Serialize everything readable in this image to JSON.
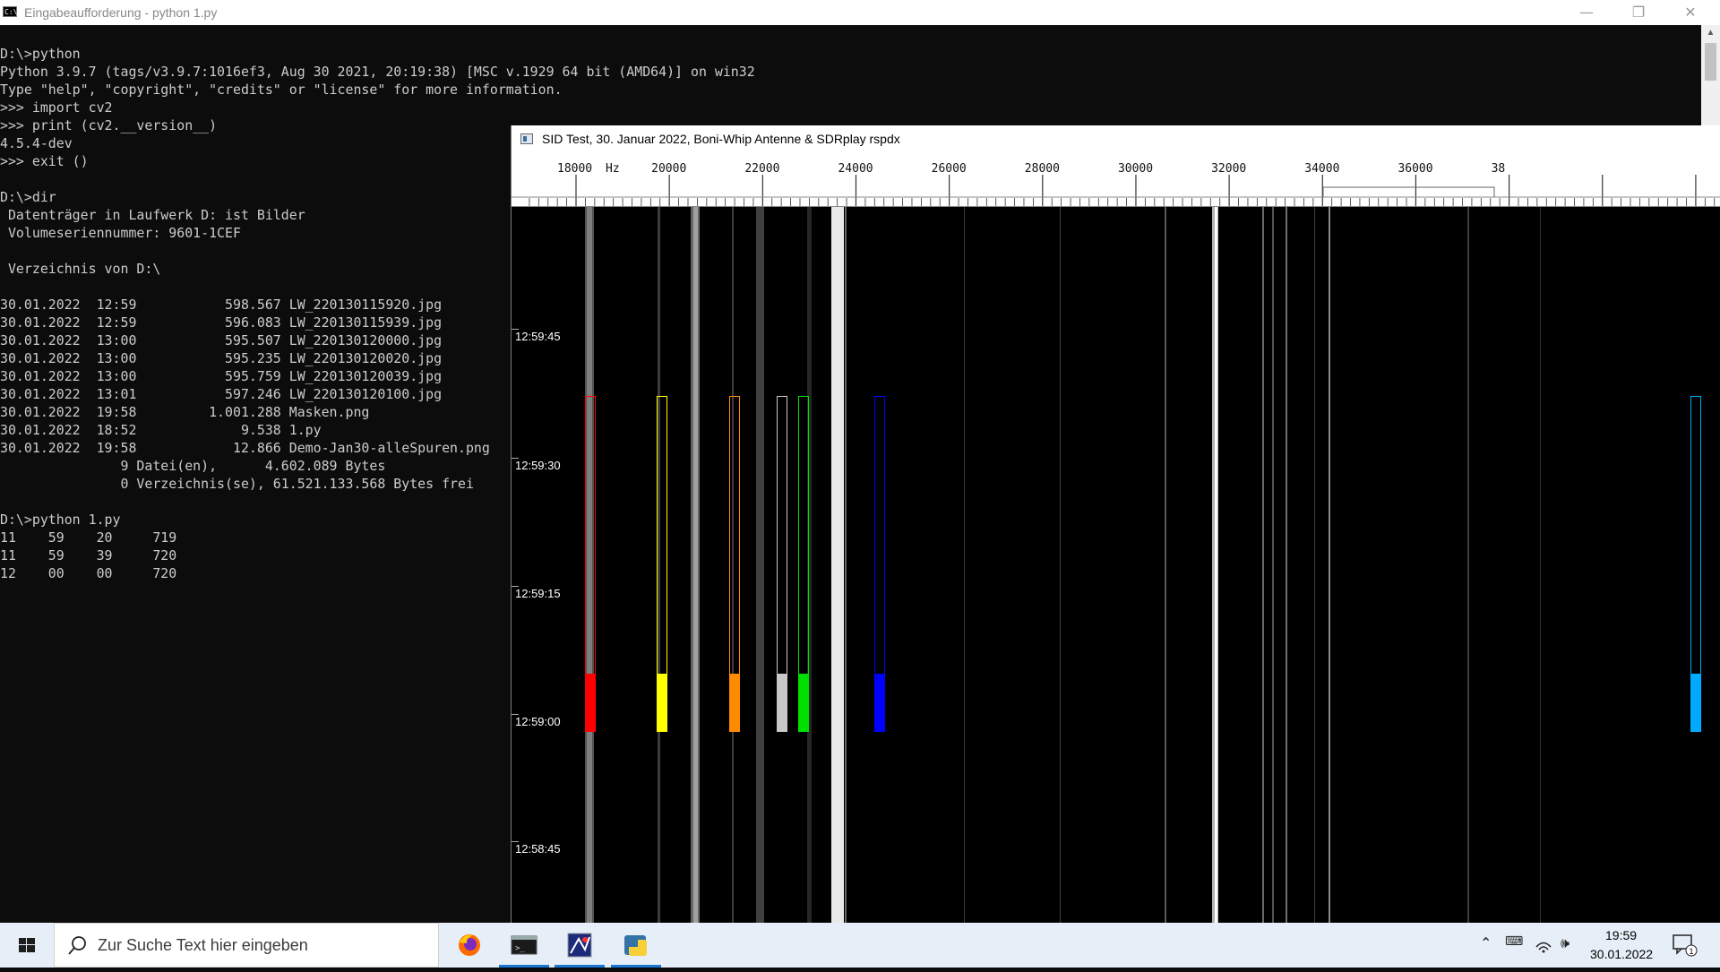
{
  "console_window": {
    "title": "Eingabeaufforderung - python  1.py",
    "lines": [
      "D:\\>python",
      "Python 3.9.7 (tags/v3.9.7:1016ef3, Aug 30 2021, 20:19:38) [MSC v.1929 64 bit (AMD64)] on win32",
      "Type \"help\", \"copyright\", \"credits\" or \"license\" for more information.",
      ">>> import cv2",
      ">>> print (cv2.__version__)",
      "4.5.4-dev",
      ">>> exit ()",
      "",
      "D:\\>dir",
      " Datenträger in Laufwerk D: ist Bilder",
      " Volumeseriennummer: 9601-1CEF",
      "",
      " Verzeichnis von D:\\",
      "",
      "30.01.2022  12:59           598.567 LW_220130115920.jpg",
      "30.01.2022  12:59           596.083 LW_220130115939.jpg",
      "30.01.2022  13:00           595.507 LW_220130120000.jpg",
      "30.01.2022  13:00           595.235 LW_220130120020.jpg",
      "30.01.2022  13:00           595.759 LW_220130120039.jpg",
      "30.01.2022  13:01           597.246 LW_220130120100.jpg",
      "30.01.2022  19:58         1.001.288 Masken.png",
      "30.01.2022  18:52             9.538 1.py",
      "30.01.2022  19:58            12.866 Demo-Jan30-alleSpuren.png",
      "               9 Datei(en),      4.602.089 Bytes",
      "               0 Verzeichnis(se), 61.521.133.568 Bytes frei",
      "",
      "D:\\>python 1.py",
      "11    59    20     719",
      "11    59    39     720",
      "12    00    00     720"
    ]
  },
  "sid_window": {
    "title": "SID Test, 30. Januar 2022, Boni-Whip Antenne & SDRplay rspdx",
    "freq_unit": "Hz",
    "freq_labels": [
      "18000",
      "20000",
      "22000",
      "24000",
      "26000",
      "28000",
      "30000",
      "32000",
      "34000",
      "36000",
      "38"
    ],
    "time_labels": [
      "12:59:45",
      "12:59:30",
      "12:59:15",
      "12:59:00",
      "12:58:45"
    ],
    "mask_colors": [
      "#ff0000",
      "#ffff00",
      "#ff8c00",
      "#c8c8c8",
      "#00e000",
      "#0000ff",
      "#00aaff"
    ]
  },
  "taskbar": {
    "search_placeholder": "Zur Suche Text hier eingeben",
    "apps": [
      "firefox-icon",
      "terminal-icon",
      "sid-app-icon",
      "python-icon"
    ],
    "clock_time": "19:59",
    "clock_date": "30.01.2022",
    "notification_count": "1"
  }
}
